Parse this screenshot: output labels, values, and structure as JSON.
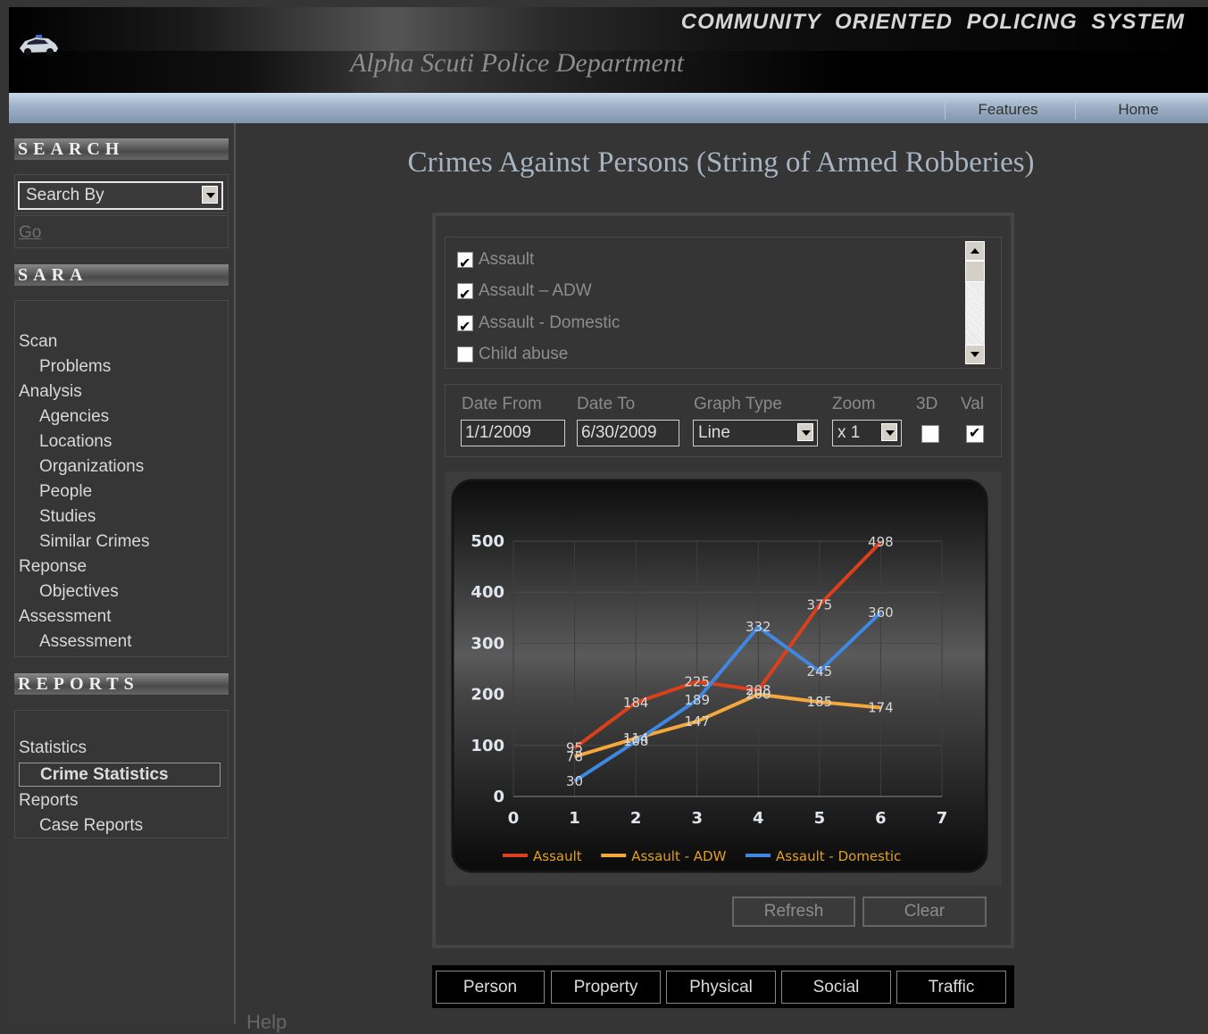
{
  "header": {
    "system_title": "COMMUNITY ORIENTED POLICING SYSTEM",
    "department": "Alpha Scuti Police Department",
    "nav": [
      "Features",
      "Home"
    ]
  },
  "sidebar": {
    "search_heading": "SEARCH",
    "search_by": "Search By",
    "go": "Go",
    "sara_heading": "SARA",
    "sara_items": [
      {
        "label": "Scan",
        "level": 0
      },
      {
        "label": "Problems",
        "level": 1
      },
      {
        "label": "Analysis",
        "level": 0
      },
      {
        "label": "Agencies",
        "level": 1
      },
      {
        "label": "Locations",
        "level": 1
      },
      {
        "label": "Organizations",
        "level": 1
      },
      {
        "label": "People",
        "level": 1
      },
      {
        "label": "Studies",
        "level": 1
      },
      {
        "label": "Similar Crimes",
        "level": 1
      },
      {
        "label": "Reponse",
        "level": 0
      },
      {
        "label": "Objectives",
        "level": 1
      },
      {
        "label": "Assessment",
        "level": 0
      },
      {
        "label": "Assessment",
        "level": 1
      }
    ],
    "reports_heading": "REPORTS",
    "reports_items": [
      {
        "label": "Statistics",
        "level": 0
      },
      {
        "label": "Crime Statistics",
        "level": 1,
        "selected": true
      },
      {
        "label": "Reports",
        "level": 0
      },
      {
        "label": "Case Reports",
        "level": 1
      }
    ],
    "help": "Help"
  },
  "main": {
    "title": "Crimes Against Persons (String of Armed Robberies)",
    "crime_types": [
      {
        "label": "Assault",
        "checked": true
      },
      {
        "label": "Assault – ADW",
        "checked": true
      },
      {
        "label": "Assault - Domestic",
        "checked": true
      },
      {
        "label": "Child abuse",
        "checked": false
      }
    ],
    "controls": {
      "date_from_label": "Date From",
      "date_from": "1/1/2009",
      "date_to_label": "Date To",
      "date_to": "6/30/2009",
      "graph_type_label": "Graph Type",
      "graph_type": "Line",
      "zoom_label": "Zoom",
      "zoom": "x 1",
      "three_d_label": "3D",
      "three_d": false,
      "val_label": "Val",
      "val": true
    },
    "buttons": {
      "refresh": "Refresh",
      "clear": "Clear"
    },
    "categories": [
      "Person",
      "Property",
      "Physical",
      "Social",
      "Traffic"
    ]
  },
  "colors": {
    "assault": "#d9401b",
    "adw": "#f4a83c",
    "domestic": "#3f87e0",
    "legend_text": "#e0a020"
  },
  "chart_data": {
    "type": "line",
    "x": [
      1,
      2,
      3,
      4,
      5,
      6
    ],
    "xlim": [
      0,
      7
    ],
    "ylim": [
      0,
      500
    ],
    "xticks": [
      "0",
      "1",
      "2",
      "3",
      "4",
      "5",
      "6",
      "7"
    ],
    "yticks": [
      "0",
      "100",
      "200",
      "300",
      "400",
      "500"
    ],
    "series": [
      {
        "name": "Assault",
        "values": [
          95,
          184,
          225,
          208,
          375,
          498
        ]
      },
      {
        "name": "Assault - ADW",
        "values": [
          78,
          114,
          147,
          200,
          185,
          174
        ]
      },
      {
        "name": "Assault - Domestic",
        "values": [
          30,
          108,
          189,
          332,
          245,
          360
        ]
      }
    ],
    "legend": "bottom",
    "grid": true
  }
}
